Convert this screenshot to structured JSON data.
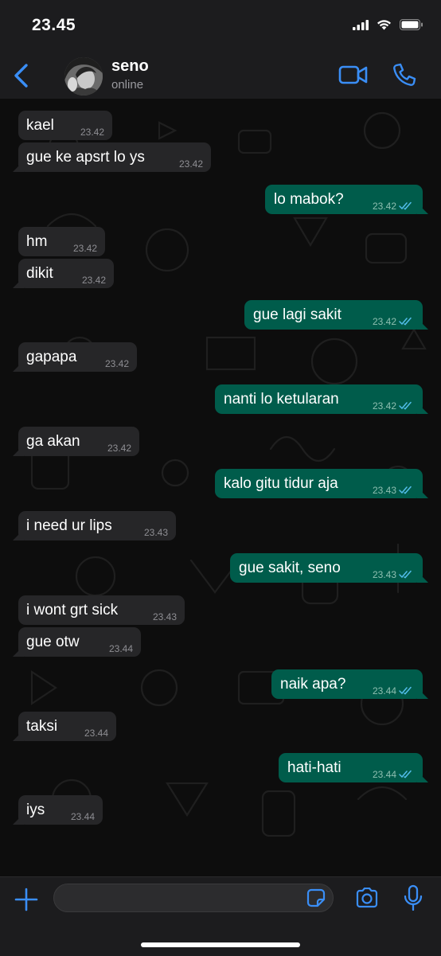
{
  "status_bar": {
    "time": "23.45",
    "signal_icon": "cellular-signal-icon",
    "wifi_icon": "wifi-icon",
    "battery_icon": "battery-icon"
  },
  "header": {
    "back_icon": "chevron-left-icon",
    "contact_name": "seno",
    "contact_status": "online",
    "video_icon": "video-camera-icon",
    "call_icon": "phone-icon"
  },
  "colors": {
    "accent": "#3a8ef6",
    "incoming_bubble": "#262628",
    "outgoing_bubble": "#005c4b",
    "read_ticks": "#53bdeb",
    "background": "#0b0b0b"
  },
  "messages": [
    {
      "direction": "in",
      "text": "kael",
      "time": "23.42"
    },
    {
      "direction": "in",
      "text": "gue ke apsrt lo ys",
      "time": "23.42"
    },
    {
      "direction": "out",
      "text": "lo mabok?",
      "time": "23.42",
      "status": "read"
    },
    {
      "direction": "in",
      "text": "hm",
      "time": "23.42"
    },
    {
      "direction": "in",
      "text": "dikit",
      "time": "23.42"
    },
    {
      "direction": "out",
      "text": "gue lagi sakit",
      "time": "23.42",
      "status": "read"
    },
    {
      "direction": "in",
      "text": "gapapa",
      "time": "23.42"
    },
    {
      "direction": "out",
      "text": "nanti lo ketularan",
      "time": "23.42",
      "status": "read"
    },
    {
      "direction": "in",
      "text": "ga akan",
      "time": "23.42"
    },
    {
      "direction": "out",
      "text": "kalo gitu tidur aja",
      "time": "23.43",
      "status": "read"
    },
    {
      "direction": "in",
      "text": "i need ur lips",
      "time": "23.43"
    },
    {
      "direction": "out",
      "text": "gue sakit, seno",
      "time": "23.43",
      "status": "read"
    },
    {
      "direction": "in",
      "text": "i wont grt sick",
      "time": "23.43"
    },
    {
      "direction": "in",
      "text": "gue otw",
      "time": "23.44"
    },
    {
      "direction": "out",
      "text": "naik apa?",
      "time": "23.44",
      "status": "read"
    },
    {
      "direction": "in",
      "text": "taksi",
      "time": "23.44"
    },
    {
      "direction": "out",
      "text": "hati-hati",
      "time": "23.44",
      "status": "read"
    },
    {
      "direction": "in",
      "text": "iys",
      "time": "23.44"
    }
  ],
  "input_bar": {
    "plus_icon": "plus-icon",
    "message_value": "",
    "sticker_icon": "sticker-icon",
    "camera_icon": "camera-icon",
    "mic_icon": "microphone-icon"
  }
}
